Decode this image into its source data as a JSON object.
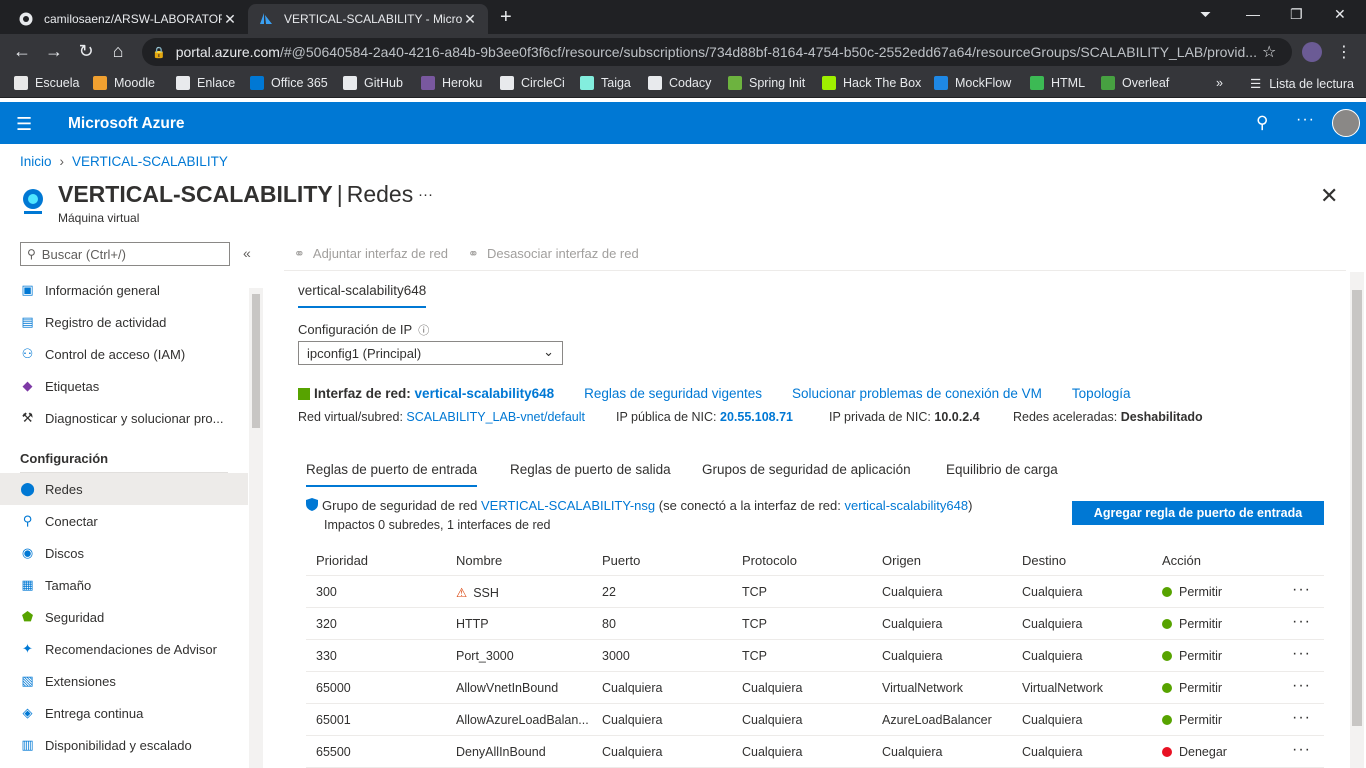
{
  "browser": {
    "tabs": [
      {
        "title": "camilosaenz/ARSW-LABORATORIO",
        "icon": "github-icon"
      },
      {
        "title": "VERTICAL-SCALABILITY - Microsoft",
        "icon": "azure-icon"
      }
    ],
    "url_host": "portal.azure.com",
    "url_path": "/#@50640584-2a40-4216-a84b-9b3ee0f3f6cf/resource/subscriptions/734d88bf-8164-4754-b50c-2552edd67a64/resourceGroups/SCALABILITY_LAB/provid...",
    "bookmarks": [
      {
        "label": "Escuela",
        "color": "#e8e8e8"
      },
      {
        "label": "Moodle",
        "color": "#f0a030"
      },
      {
        "label": "Enlace",
        "color": "#e8eaed"
      },
      {
        "label": "Office 365",
        "color": "#0078d4"
      },
      {
        "label": "GitHub",
        "color": "#e8eaed"
      },
      {
        "label": "Heroku",
        "color": "#79589f"
      },
      {
        "label": "CircleCi",
        "color": "#e8eaed"
      },
      {
        "label": "Taiga",
        "color": "#83eede"
      },
      {
        "label": "Codacy",
        "color": "#e8eaed"
      },
      {
        "label": "Spring Init",
        "color": "#6db33f"
      },
      {
        "label": "Hack The Box",
        "color": "#9fef00"
      },
      {
        "label": "MockFlow",
        "color": "#1e88e5"
      },
      {
        "label": "HTML",
        "color": "#3cba54"
      },
      {
        "label": "Overleaf",
        "color": "#47a141"
      }
    ],
    "reading_list": "Lista de lectura"
  },
  "azure": {
    "brand": "Microsoft Azure"
  },
  "breadcrumb": {
    "home": "Inicio",
    "current": "VERTICAL-SCALABILITY"
  },
  "page": {
    "resource": "VERTICAL-SCALABILITY",
    "section": "Redes",
    "subtitle": "Máquina virtual"
  },
  "sidebar": {
    "search_placeholder": "Buscar (Ctrl+/)",
    "items_top": [
      {
        "label": "Información general",
        "icon": "overview-icon"
      },
      {
        "label": "Registro de actividad",
        "icon": "activity-log-icon"
      },
      {
        "label": "Control de acceso (IAM)",
        "icon": "iam-icon"
      },
      {
        "label": "Etiquetas",
        "icon": "tag-icon"
      },
      {
        "label": "Diagnosticar y solucionar pro...",
        "icon": "wrench-icon"
      }
    ],
    "section_config": "Configuración",
    "items_config": [
      {
        "label": "Redes",
        "icon": "network-icon"
      },
      {
        "label": "Conectar",
        "icon": "connect-icon"
      },
      {
        "label": "Discos",
        "icon": "disk-icon"
      },
      {
        "label": "Tamaño",
        "icon": "size-icon"
      },
      {
        "label": "Seguridad",
        "icon": "security-icon"
      },
      {
        "label": "Recomendaciones de Advisor",
        "icon": "advisor-icon"
      },
      {
        "label": "Extensiones",
        "icon": "extensions-icon"
      },
      {
        "label": "Entrega continua",
        "icon": "delivery-icon"
      },
      {
        "label": "Disponibilidad y escalado",
        "icon": "availability-icon"
      }
    ]
  },
  "toolbar": {
    "attach": "Adjuntar interfaz de red",
    "detach": "Desasociar interfaz de red"
  },
  "nic": {
    "tab": "vertical-scalability648",
    "ip_config_label": "Configuración de IP",
    "ip_config_value": "ipconfig1 (Principal)",
    "interface_label": "Interfaz de red:",
    "interface_name": "vertical-scalability648",
    "links": [
      "Reglas de seguridad vigentes",
      "Solucionar problemas de conexión de VM",
      "Topología"
    ],
    "vnet_label": "Red virtual/subred:",
    "vnet_value": "SCALABILITY_LAB-vnet/default",
    "public_ip_label": "IP pública de NIC:",
    "public_ip_value": "20.55.108.71",
    "private_ip_label": "IP privada de NIC:",
    "private_ip_value": "10.0.2.4",
    "accel_label": "Redes aceleradas:",
    "accel_value": "Deshabilitado"
  },
  "rule_tabs": [
    "Reglas de puerto de entrada",
    "Reglas de puerto de salida",
    "Grupos de seguridad de aplicación",
    "Equilibrio de carga"
  ],
  "nsg": {
    "prefix": "Grupo de seguridad de red",
    "name": "VERTICAL-SCALABILITY-nsg",
    "middle": "(se conectó a la interfaz de red:",
    "nic": "vertical-scalability648",
    "suffix": ")",
    "impacts": "Impactos 0 subredes, 1 interfaces de red",
    "add_button": "Agregar regla de puerto de entrada"
  },
  "table": {
    "headers": [
      "Prioridad",
      "Nombre",
      "Puerto",
      "Protocolo",
      "Origen",
      "Destino",
      "Acción"
    ],
    "rows": [
      {
        "priority": "300",
        "name": "SSH",
        "warn": true,
        "port": "22",
        "protocol": "TCP",
        "source": "Cualquiera",
        "dest": "Cualquiera",
        "action": "Permitir",
        "allow": true
      },
      {
        "priority": "320",
        "name": "HTTP",
        "warn": false,
        "port": "80",
        "protocol": "TCP",
        "source": "Cualquiera",
        "dest": "Cualquiera",
        "action": "Permitir",
        "allow": true
      },
      {
        "priority": "330",
        "name": "Port_3000",
        "warn": false,
        "port": "3000",
        "protocol": "TCP",
        "source": "Cualquiera",
        "dest": "Cualquiera",
        "action": "Permitir",
        "allow": true
      },
      {
        "priority": "65000",
        "name": "AllowVnetInBound",
        "warn": false,
        "port": "Cualquiera",
        "protocol": "Cualquiera",
        "source": "VirtualNetwork",
        "dest": "VirtualNetwork",
        "action": "Permitir",
        "allow": true
      },
      {
        "priority": "65001",
        "name": "AllowAzureLoadBalan...",
        "warn": false,
        "port": "Cualquiera",
        "protocol": "Cualquiera",
        "source": "AzureLoadBalancer",
        "dest": "Cualquiera",
        "action": "Permitir",
        "allow": true
      },
      {
        "priority": "65500",
        "name": "DenyAllInBound",
        "warn": false,
        "port": "Cualquiera",
        "protocol": "Cualquiera",
        "source": "Cualquiera",
        "dest": "Cualquiera",
        "action": "Denegar",
        "allow": false
      }
    ]
  }
}
